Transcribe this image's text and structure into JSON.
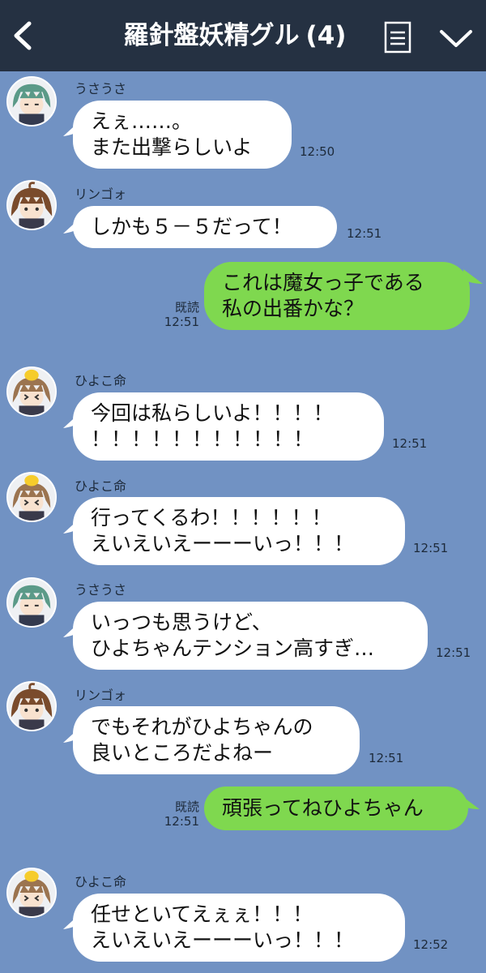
{
  "header": {
    "title": "羅針盤妖精グル",
    "member_count": "(4)"
  },
  "messages": [
    {
      "sender": "うさうさ",
      "lines": [
        "えぇ……。",
        "また出撃らしいよ"
      ],
      "time": "12:50",
      "avatar": "green-hair"
    },
    {
      "sender": "リンゴォ",
      "lines": [
        "しかも５－５だって！"
      ],
      "time": "12:51",
      "avatar": "brown-hair"
    },
    {
      "outgoing": true,
      "read_label": "既読",
      "lines": [
        "これは魔女っ子である",
        "私の出番かな？"
      ],
      "time": "12:51"
    },
    {
      "sender": "ひよこ命",
      "lines": [
        "今回は私らしいよ！！！！",
        "！！！！！！！！！！！"
      ],
      "time": "12:51",
      "avatar": "chick-hat"
    },
    {
      "sender": "ひよこ命",
      "lines": [
        "行ってくるわ！！！！！！",
        "えいえいえーーーいっ！！！"
      ],
      "time": "12:51",
      "avatar": "chick-hat"
    },
    {
      "sender": "うさうさ",
      "lines": [
        "いっつも思うけど、",
        "ひよちゃんテンション高すぎ…"
      ],
      "time": "12:51",
      "avatar": "green-hair"
    },
    {
      "sender": "リンゴォ",
      "lines": [
        "でもそれがひよちゃんの",
        "良いところだよねー"
      ],
      "time": "12:51",
      "avatar": "brown-hair"
    },
    {
      "outgoing": true,
      "read_label": "既読",
      "lines": [
        "頑張ってねひよちゃん"
      ],
      "time": "12:51"
    },
    {
      "sender": "ひよこ命",
      "lines": [
        "任せといてえぇぇ！！！",
        "えいえいえーーーいっ！！！"
      ],
      "time": "12:52",
      "avatar": "chick-hat"
    }
  ],
  "colors": {
    "background": "#7192c3",
    "header": "#253142",
    "incoming_bubble": "#ffffff",
    "outgoing_bubble": "#7fd84f"
  }
}
